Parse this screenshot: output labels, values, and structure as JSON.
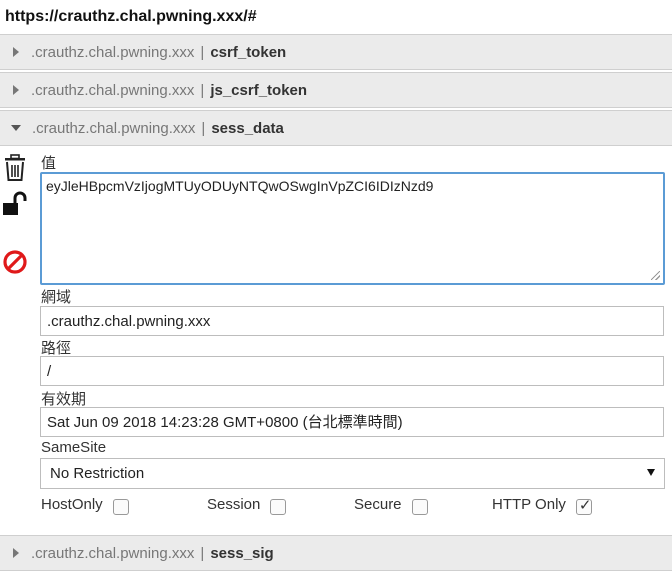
{
  "url": "https://crauthz.chal.pwning.xxx/#",
  "cookies": [
    {
      "domain": ".crauthz.chal.pwning.xxx",
      "separator": "|",
      "name": "csrf_token",
      "expanded": false
    },
    {
      "domain": ".crauthz.chal.pwning.xxx",
      "separator": "|",
      "name": "js_csrf_token",
      "expanded": false
    },
    {
      "domain": ".crauthz.chal.pwning.xxx",
      "separator": "|",
      "name": "sess_data",
      "expanded": true
    },
    {
      "domain": ".crauthz.chal.pwning.xxx",
      "separator": "|",
      "name": "sess_sig",
      "expanded": false
    }
  ],
  "editor": {
    "value_label": "值",
    "value": "eyJleHBpcmVzIjogMTUyODUyNTQwOSwgInVpZCI6IDIzNzd9",
    "domain_label": "網域",
    "domain": ".crauthz.chal.pwning.xxx",
    "path_label": "路徑",
    "path": "/",
    "expiry_label": "有效期",
    "expiry": "Sat Jun 09 2018 14:23:28 GMT+0800 (台北標準時間)",
    "samesite_label": "SameSite",
    "samesite": "No Restriction",
    "flags": {
      "hostonly_label": "HostOnly",
      "hostonly": false,
      "session_label": "Session",
      "session": false,
      "secure_label": "Secure",
      "secure": false,
      "httponly_label": "HTTP Only",
      "httponly": true
    }
  },
  "icons": {
    "delete": "trash-icon",
    "unlock": "unlock-icon",
    "block": "block-icon"
  },
  "colors": {
    "row_bg": "#ebebeb",
    "focus_border": "#5b9bd5",
    "block_red": "#e0191a"
  }
}
